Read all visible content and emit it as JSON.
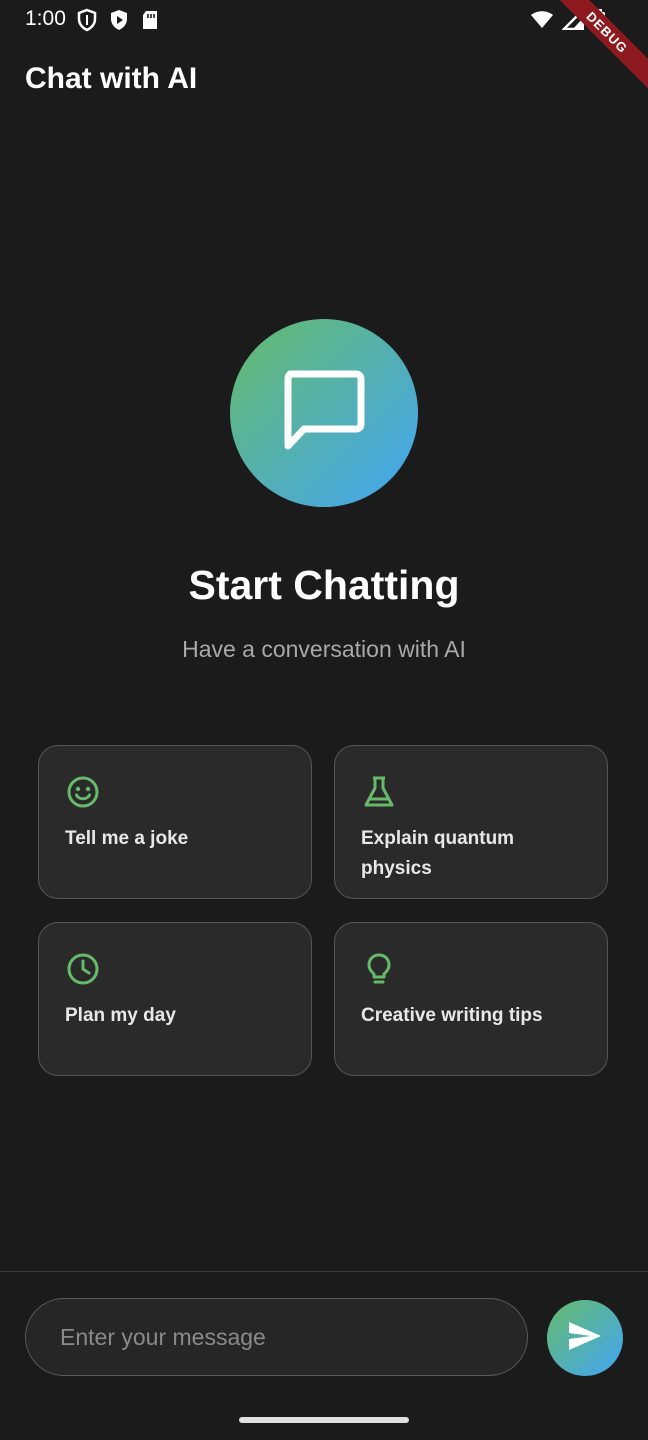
{
  "status_bar": {
    "time": "1:00",
    "left_icons": [
      "shield-icon",
      "play-protect-icon",
      "sd-card-icon"
    ],
    "right_icons": [
      "wifi-icon",
      "signal-icon",
      "battery-icon"
    ],
    "debug_label": "DEBUG"
  },
  "app_bar": {
    "title": "Chat with AI"
  },
  "hero": {
    "icon": "chat-bubble-icon",
    "title": "Start Chatting",
    "subtitle": "Have a conversation with AI"
  },
  "suggestions": [
    {
      "label": "Tell me a joke",
      "icon": "smiley-icon"
    },
    {
      "label": "Explain quantum physics",
      "icon": "flask-icon"
    },
    {
      "label": "Plan my day",
      "icon": "clock-icon"
    },
    {
      "label": "Creative writing tips",
      "icon": "lightbulb-icon"
    }
  ],
  "composer": {
    "placeholder": "Enter your message",
    "value": "",
    "send_icon": "send-icon"
  },
  "colors": {
    "background": "#1b1b1b",
    "card": "#2a2a2a",
    "accent_green": "#66bb6a",
    "accent_blue": "#42a5f5"
  }
}
